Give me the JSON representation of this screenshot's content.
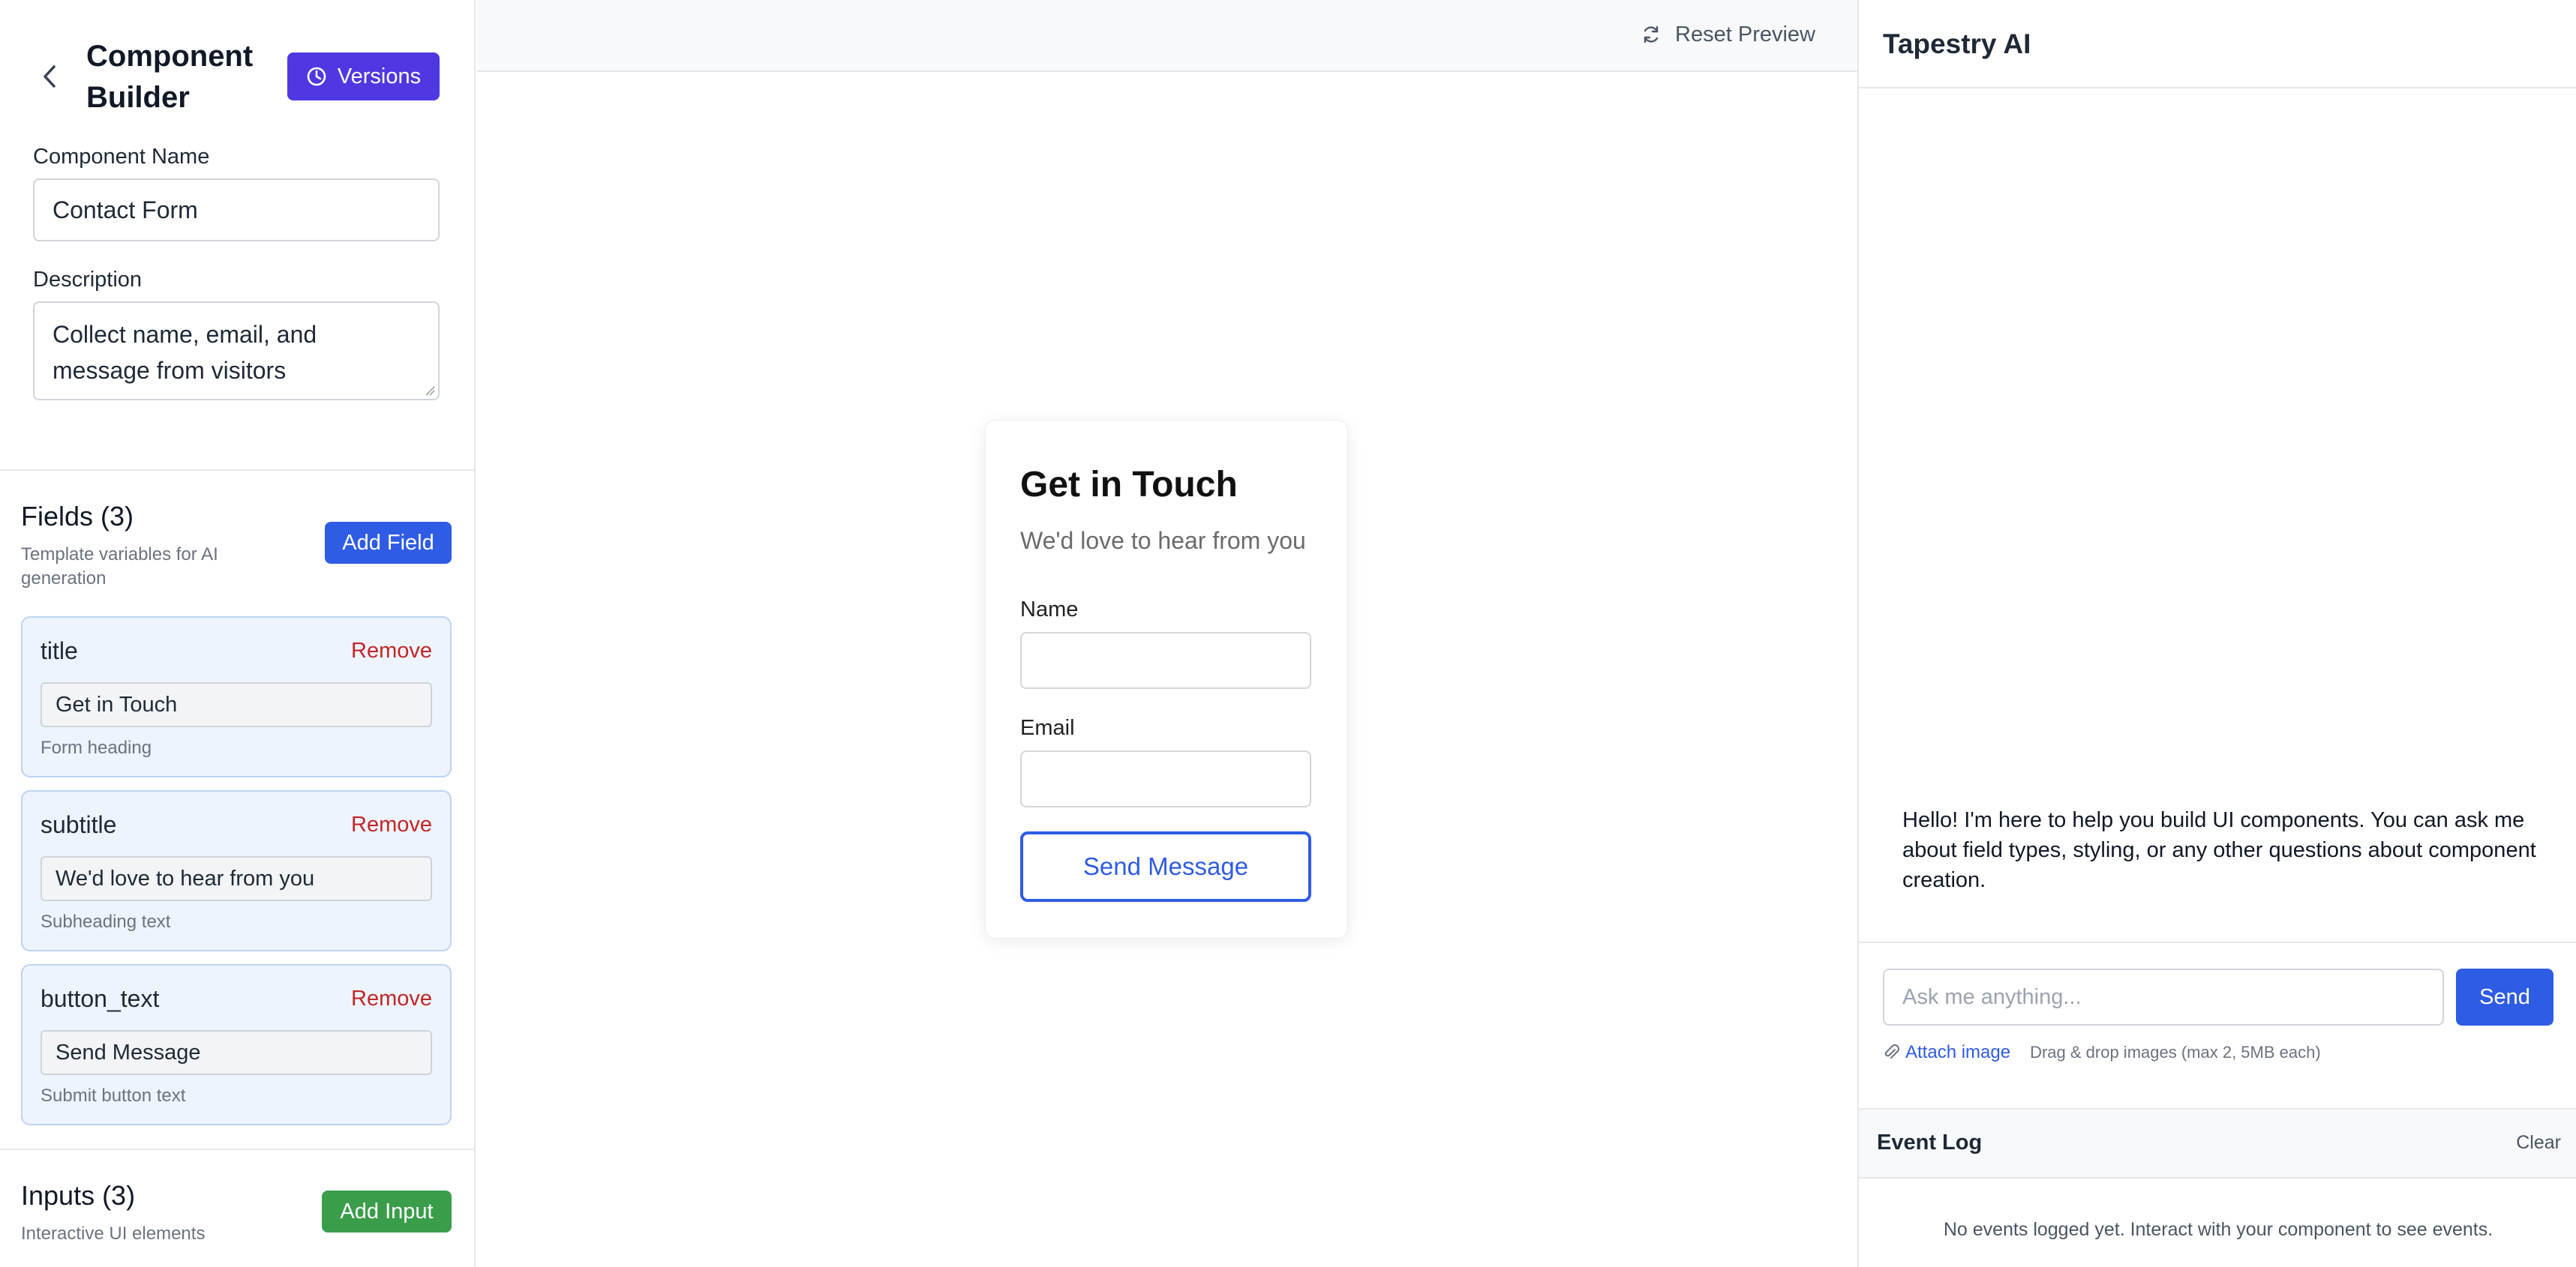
{
  "builder": {
    "title": "Component Builder",
    "versions_label": "Versions",
    "name_label": "Component Name",
    "name_value": "Contact Form",
    "description_label": "Description",
    "description_value": "Collect name, email, and message from visitors"
  },
  "fields_section": {
    "title": "Fields (3)",
    "subtitle": "Template variables for AI generation",
    "add_label": "Add Field",
    "remove_label": "Remove",
    "items": [
      {
        "name": "title",
        "value": "Get in Touch",
        "hint": "Form heading"
      },
      {
        "name": "subtitle",
        "value": "We'd love to hear from you",
        "hint": "Subheading text"
      },
      {
        "name": "button_text",
        "value": "Send Message",
        "hint": "Submit button text"
      }
    ]
  },
  "inputs_section": {
    "title": "Inputs (3)",
    "subtitle": "Interactive UI elements",
    "add_label": "Add Input"
  },
  "preview": {
    "reset_label": "Reset Preview",
    "card": {
      "title": "Get in Touch",
      "subtitle": "We'd love to hear from you",
      "name_label": "Name",
      "email_label": "Email",
      "button_label": "Send Message"
    }
  },
  "assistant": {
    "title": "Tapestry AI",
    "message": "Hello! I'm here to help you build UI components. You can ask me about field types, styling, or any other questions about component creation.",
    "input_placeholder": "Ask me anything...",
    "send_label": "Send",
    "attach_label": "Attach image",
    "attach_hint": "Drag & drop images (max 2, 5MB each)"
  },
  "event_log": {
    "title": "Event Log",
    "clear_label": "Clear",
    "empty_text": "No events logged yet. Interact with your component to see events."
  },
  "colors": {
    "versions_button": "#4f38e2",
    "primary": "#2f5ce4",
    "add_input_green": "#3a9d4a",
    "remove_red": "#c02727",
    "field_card_bg": "#eef4fd"
  },
  "icons": [
    "chevron-left-icon",
    "clock-icon",
    "refresh-icon",
    "paperclip-icon"
  ]
}
